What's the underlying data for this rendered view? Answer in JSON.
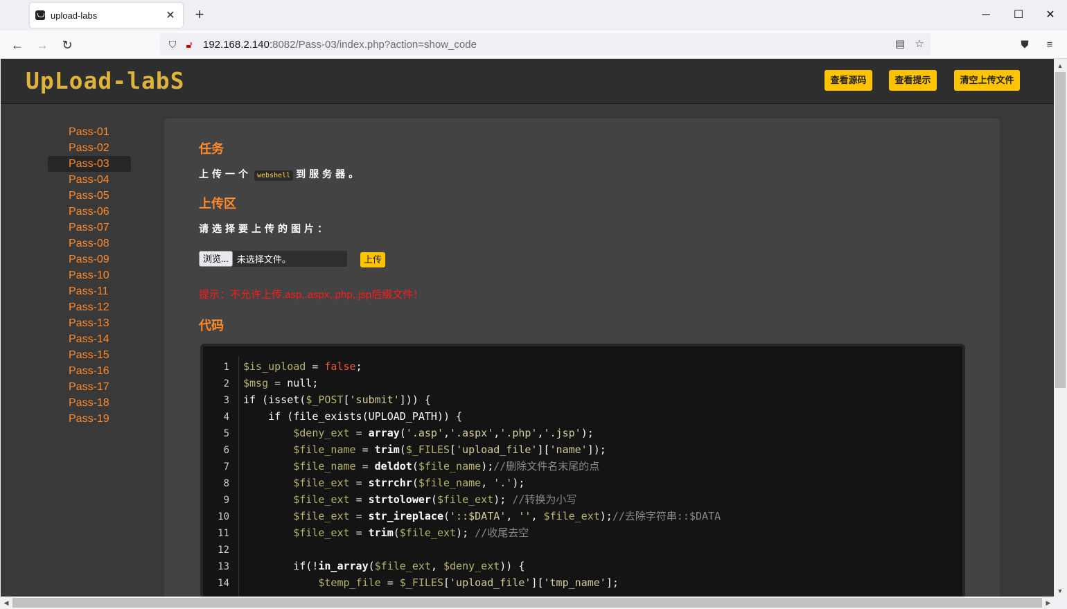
{
  "browser": {
    "tab_title": "upload-labs",
    "tab_close": "✕",
    "new_tab": "+",
    "url_host": "192.168.2.140",
    "url_rest": ":8082/Pass-03/index.php?action=show_code",
    "window_minimize": "─",
    "window_maximize": "☐",
    "window_close": "✕"
  },
  "header": {
    "logo": "UpLoad-labS",
    "buttons": [
      "查看源码",
      "查看提示",
      "清空上传文件"
    ]
  },
  "sidebar": {
    "items": [
      "Pass-01",
      "Pass-02",
      "Pass-03",
      "Pass-04",
      "Pass-05",
      "Pass-06",
      "Pass-07",
      "Pass-08",
      "Pass-09",
      "Pass-10",
      "Pass-11",
      "Pass-12",
      "Pass-13",
      "Pass-14",
      "Pass-15",
      "Pass-16",
      "Pass-17",
      "Pass-18",
      "Pass-19"
    ],
    "active": "Pass-03"
  },
  "task": {
    "heading": "任务",
    "text_before": "上传一个",
    "inline_code": "webshell",
    "text_after": "到服务器。"
  },
  "upload": {
    "heading": "上传区",
    "prompt": "请选择要上传的图片：",
    "browse_label": "浏览...",
    "file_label": "未选择文件。",
    "submit_label": "上传",
    "warning": "提示：不允许上传.asp,.aspx,.php,.jsp后缀文件！"
  },
  "code": {
    "heading": "代码",
    "line_numbers": [
      "1",
      "2",
      "3",
      "4",
      "5",
      "6",
      "7",
      "8",
      "9",
      "10",
      "11",
      "12",
      "13",
      "14"
    ]
  },
  "colors": {
    "accent": "#ff8a2a",
    "button": "#ffc400",
    "warning": "#ff1a1a"
  }
}
